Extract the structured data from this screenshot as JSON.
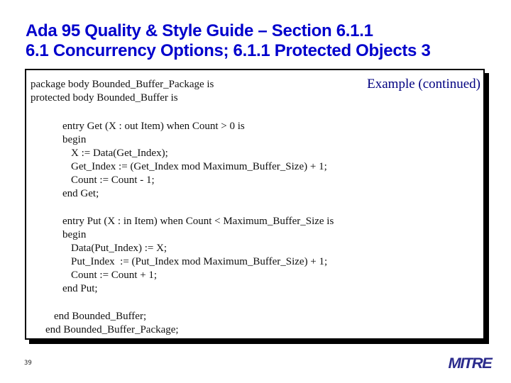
{
  "header": {
    "title_line1": "Ada 95 Quality & Style Guide – Section 6.1.1",
    "title_line2": "6.1 Concurrency Options; 6.1.1 Protected Objects 3"
  },
  "box": {
    "caption": "Example (continued)",
    "code_lines": [
      "package body Bounded_Buffer_Package is",
      "protected body Bounded_Buffer is",
      "entry Get (X : out Item) when Count > 0 is",
      "begin",
      "X := Data(Get_Index);",
      "Get_Index := (Get_Index mod Maximum_Buffer_Size) + 1;",
      "Count := Count - 1;",
      "end Get;",
      "entry Put (X : in Item) when Count < Maximum_Buffer_Size is",
      "begin",
      "Data(Put_Index) := X;",
      "Put_Index  := (Put_Index mod Maximum_Buffer_Size) + 1;",
      "Count := Count + 1;",
      "end Put;",
      "end Bounded_Buffer;",
      "end Bounded_Buffer_Package;"
    ]
  },
  "footer": {
    "page_number": "39",
    "logo_text": "MITRE"
  }
}
